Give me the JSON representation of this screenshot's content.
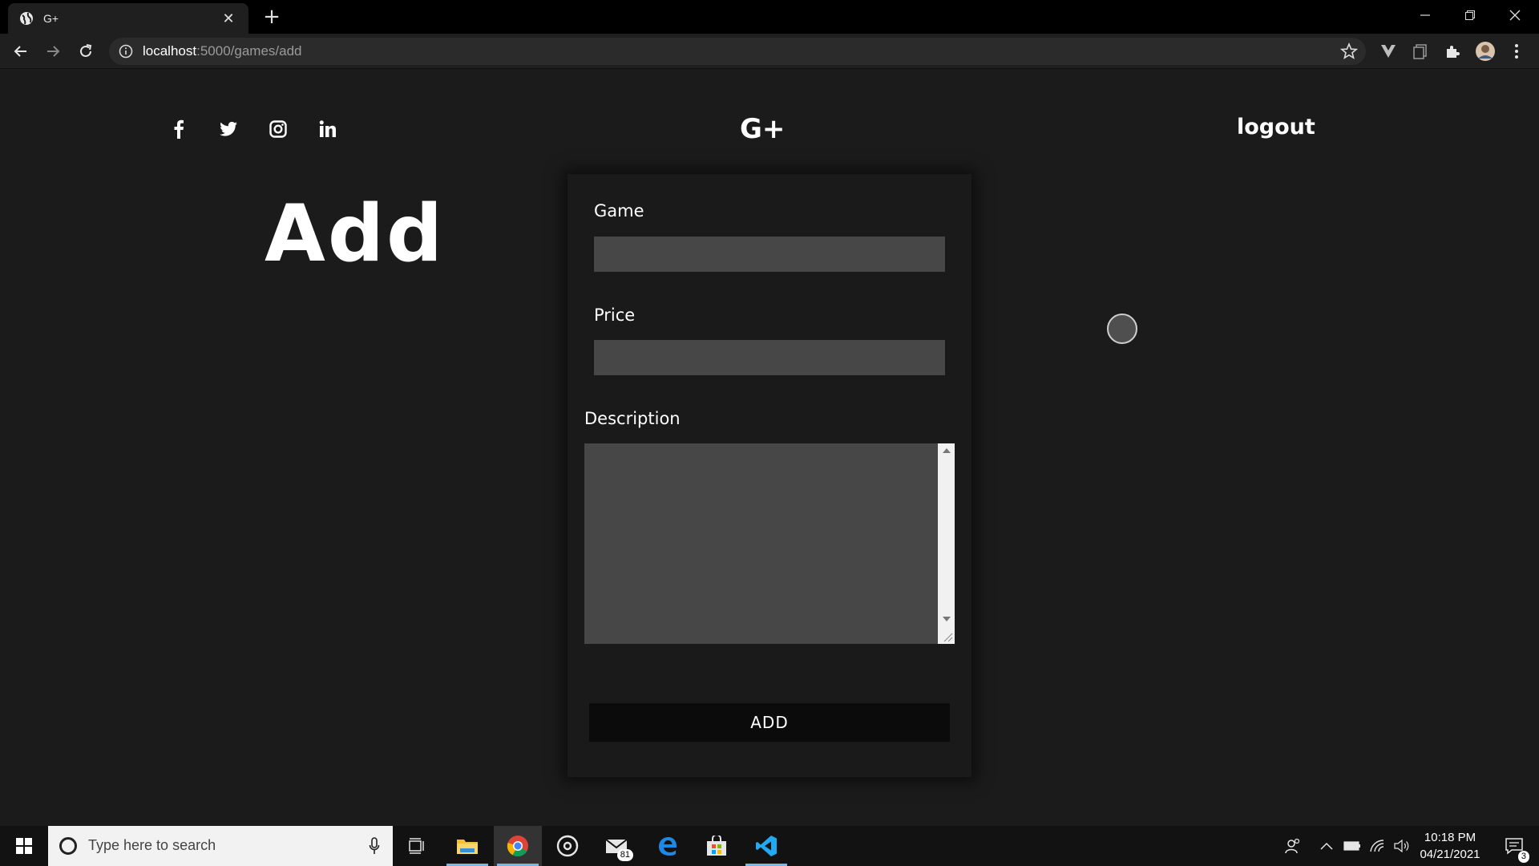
{
  "browser": {
    "tab": {
      "title": "G+"
    },
    "url": {
      "host": "localhost",
      "path": ":5000/games/add"
    }
  },
  "header": {
    "social_icons": [
      "facebook-icon",
      "twitter-icon",
      "instagram-icon",
      "linkedin-icon"
    ],
    "brand": "G+",
    "logout_label": "logout"
  },
  "main": {
    "title": "Add",
    "form": {
      "game_label": "Game",
      "game_value": "",
      "price_label": "Price",
      "price_value": "",
      "description_label": "Description",
      "description_value": "",
      "submit_label": "ADD"
    }
  },
  "taskbar": {
    "search_placeholder": "Type here to search",
    "mail_badge": "81",
    "time": "10:18 PM",
    "date": "04/21/2021",
    "notification_count": "3"
  },
  "colors": {
    "page_bg": "#1b1b1b",
    "card_bg": "#1a1a1a",
    "input_bg": "#474747",
    "button_bg": "#0b0b0b",
    "text": "#ffffff"
  }
}
